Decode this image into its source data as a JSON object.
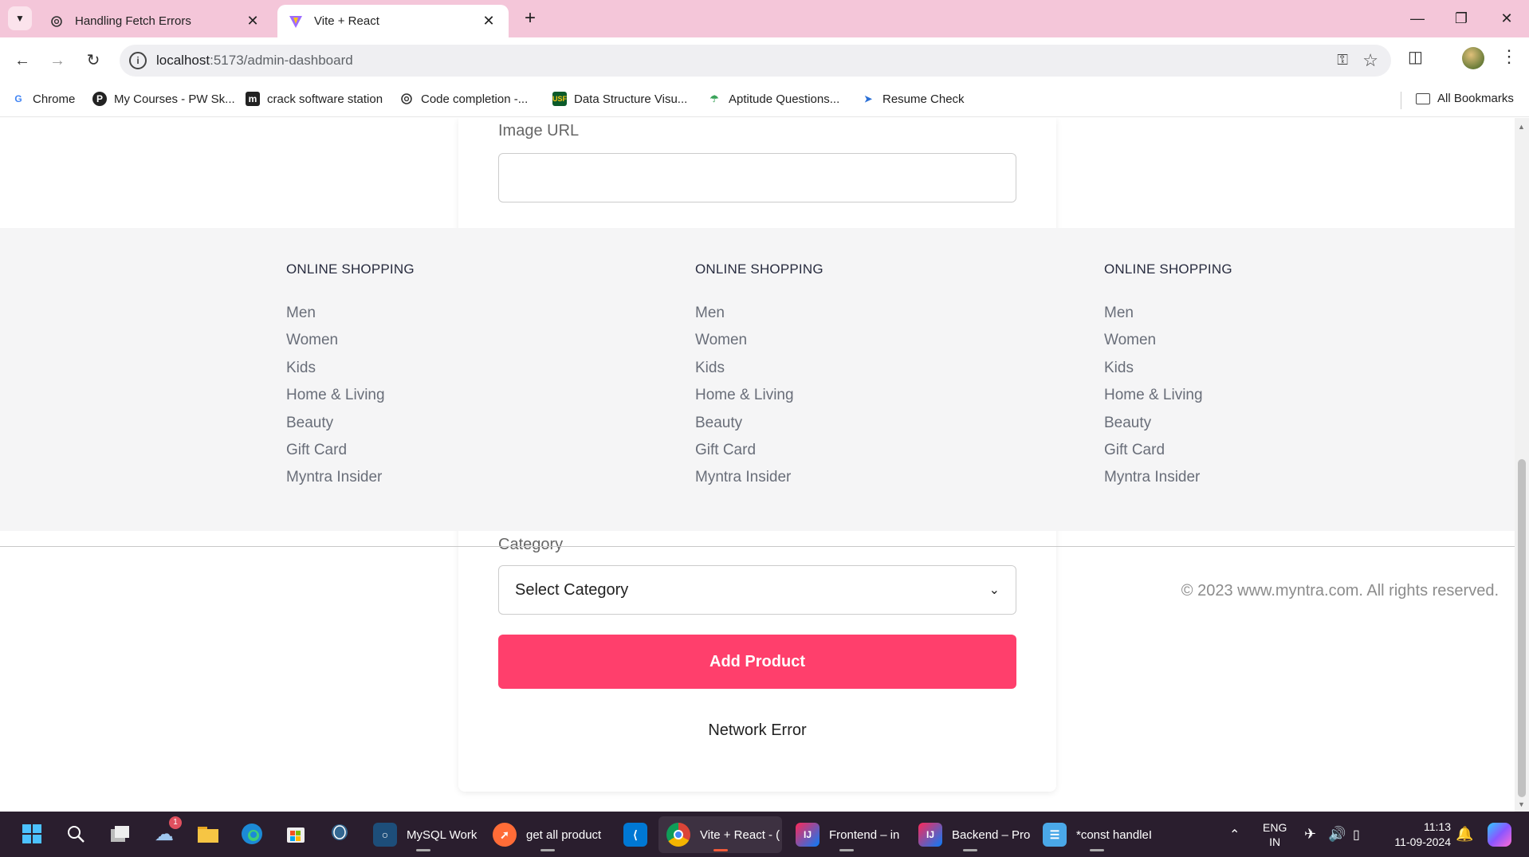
{
  "browser": {
    "tabs": [
      {
        "title": "Handling Fetch Errors",
        "icon": "openai-icon",
        "active": false
      },
      {
        "title": "Vite + React",
        "icon": "vite-icon",
        "active": true
      }
    ],
    "url_host": "localhost",
    "url_path": ":5173/admin-dashboard",
    "bookmarks": [
      {
        "label": "Chrome",
        "icon": "google-icon"
      },
      {
        "label": "My Courses - PW Sk...",
        "icon": "pw-icon"
      },
      {
        "label": "crack software station",
        "icon": "m-icon"
      },
      {
        "label": "Code completion -...",
        "icon": "openai-icon"
      },
      {
        "label": "Data Structure Visu...",
        "icon": "usf-icon"
      },
      {
        "label": "Aptitude Questions...",
        "icon": "umbrella-icon"
      },
      {
        "label": "Resume Check",
        "icon": "resume-icon"
      }
    ],
    "all_bookmarks": "All Bookmarks"
  },
  "form": {
    "image_url_label": "Image URL",
    "image_url_value": "",
    "category_label": "Category",
    "category_selected": "Select Category",
    "submit_label": "Add Product",
    "status_message": "Network Error",
    "accent_color": "#ff3f6c"
  },
  "footer": {
    "columns": [
      {
        "heading": "ONLINE SHOPPING",
        "links": [
          "Men",
          "Women",
          "Kids",
          "Home & Living",
          "Beauty",
          "Gift Card",
          "Myntra Insider"
        ]
      },
      {
        "heading": "ONLINE SHOPPING",
        "links": [
          "Men",
          "Women",
          "Kids",
          "Home & Living",
          "Beauty",
          "Gift Card",
          "Myntra Insider"
        ]
      },
      {
        "heading": "ONLINE SHOPPING",
        "links": [
          "Men",
          "Women",
          "Kids",
          "Home & Living",
          "Beauty",
          "Gift Card",
          "Myntra Insider"
        ]
      }
    ],
    "copyright": "© 2023 www.myntra.com. All rights reserved."
  },
  "taskbar": {
    "pinned": [
      "windows-start-icon",
      "search-icon",
      "task-view-icon",
      "weather-icon",
      "file-explorer-icon",
      "edge-icon",
      "store-icon",
      "postgres-icon"
    ],
    "weather_badge": "1",
    "apps": [
      {
        "label": "MySQL Work",
        "icon": "mysql-icon"
      },
      {
        "label": "get all product",
        "icon": "postman-icon"
      },
      {
        "label": "",
        "icon": "vscode-icon"
      },
      {
        "label": "Vite + React - (",
        "icon": "chrome-icon"
      },
      {
        "label": "Frontend – in",
        "icon": "intellij-icon"
      },
      {
        "label": "Backend – Pro",
        "icon": "intellij-icon"
      },
      {
        "label": "*const handleI",
        "icon": "notepad-icon"
      }
    ],
    "lang_line1": "ENG",
    "lang_line2": "IN",
    "time": "11:13",
    "date": "11-09-2024"
  }
}
